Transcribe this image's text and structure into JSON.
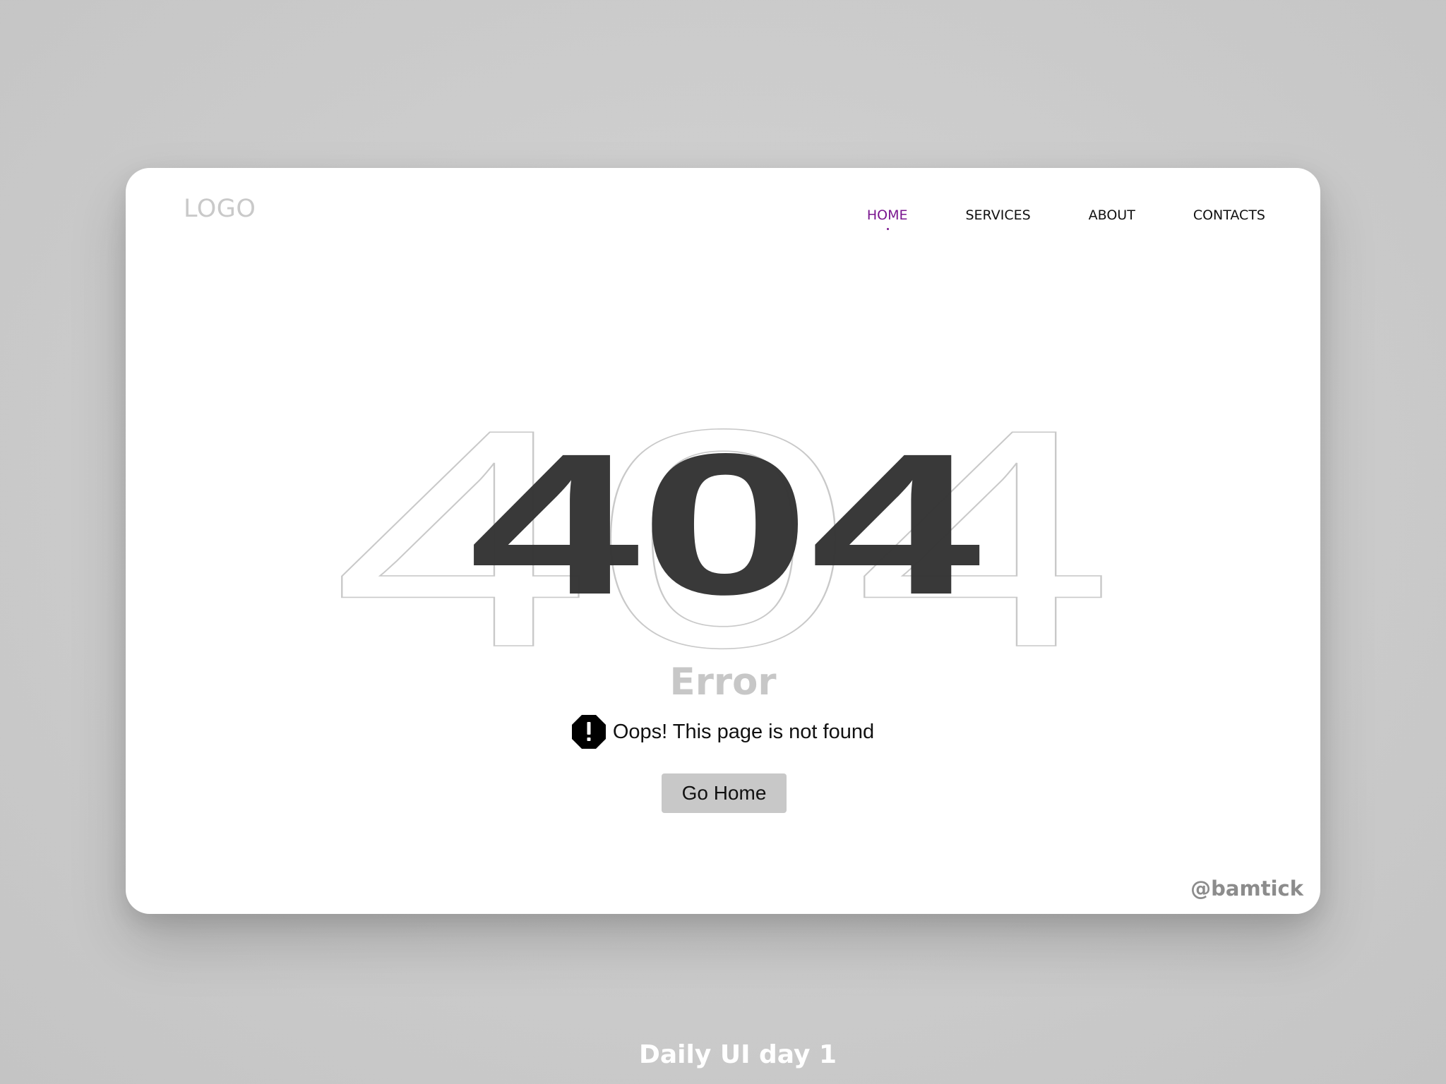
{
  "brand": {
    "logo_text": "LOGO",
    "accent_color": "#7a168f"
  },
  "nav": {
    "items": [
      {
        "label": "HOME",
        "active": true
      },
      {
        "label": "SERVICES",
        "active": false
      },
      {
        "label": "ABOUT",
        "active": false
      },
      {
        "label": "CONTACTS",
        "active": false
      }
    ]
  },
  "hero": {
    "code": "404",
    "outline_code": "404",
    "code_color": "#333333",
    "outline_color": "#c9c9c9"
  },
  "error": {
    "title": "Error",
    "message": "Oops! This page is not found",
    "icon": "alert-octagon-icon"
  },
  "actions": {
    "go_home_label": "Go Home"
  },
  "credit": "@bamtick",
  "caption": "Daily UI day 1"
}
